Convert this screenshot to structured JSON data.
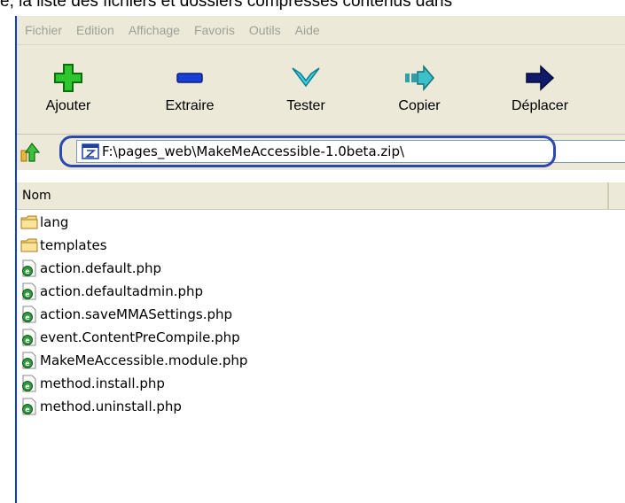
{
  "caption": "e, la liste des fichiers et dossiers compressés contenus dans",
  "menu": [
    "Fichier",
    "Edition",
    "Affichage",
    "Favoris",
    "Outils",
    "Aide"
  ],
  "toolbar": {
    "buttons": [
      {
        "label": "Ajouter",
        "icon": "add-icon"
      },
      {
        "label": "Extraire",
        "icon": "extract-icon"
      },
      {
        "label": "Tester",
        "icon": "test-icon"
      },
      {
        "label": "Copier",
        "icon": "copy-icon"
      },
      {
        "label": "Déplacer",
        "icon": "move-icon"
      }
    ]
  },
  "address": {
    "path": "F:\\pages_web\\MakeMeAccessible-1.0beta.zip\\",
    "icon": "zip-archive-icon"
  },
  "list": {
    "column_name": "Nom",
    "items": [
      {
        "name": "lang",
        "type": "folder"
      },
      {
        "name": "templates",
        "type": "folder"
      },
      {
        "name": "action.default.php",
        "type": "file"
      },
      {
        "name": "action.defaultadmin.php",
        "type": "file"
      },
      {
        "name": "action.saveMMASettings.php",
        "type": "file"
      },
      {
        "name": "event.ContentPreCompile.php",
        "type": "file"
      },
      {
        "name": "MakeMeAccessible.module.php",
        "type": "file"
      },
      {
        "name": "method.install.php",
        "type": "file"
      },
      {
        "name": "method.uninstall.php",
        "type": "file"
      }
    ]
  },
  "colors": {
    "highlight_outline": "#2b47b0",
    "chrome": "#ece9d8",
    "folder": "#f5d97c"
  }
}
